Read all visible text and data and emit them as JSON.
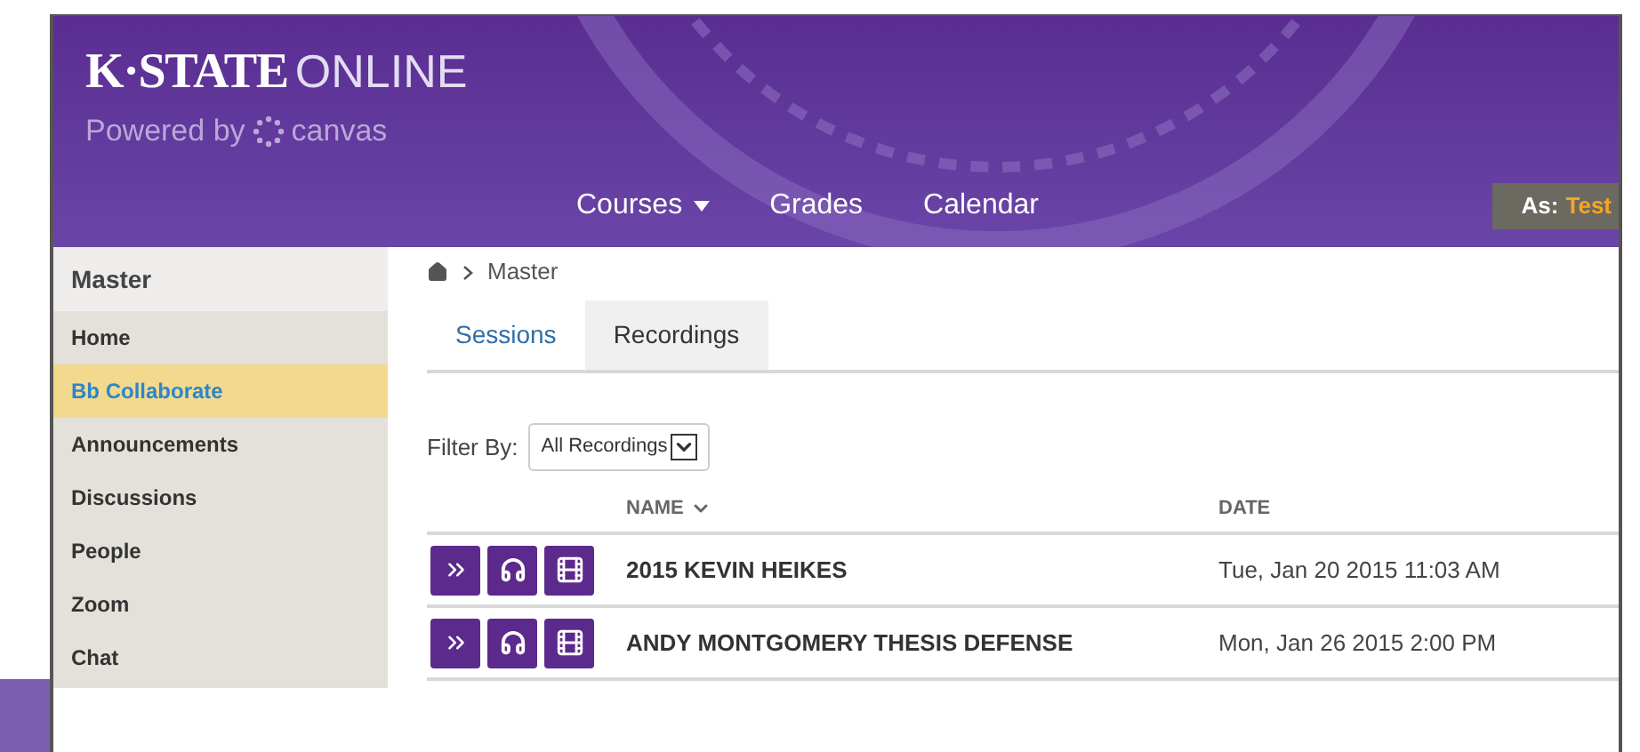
{
  "header": {
    "logo": {
      "brand": "K·STATE",
      "suffix": "ONLINE",
      "powered_by": "Powered by",
      "platform": "canvas"
    },
    "nav": [
      {
        "label": "Courses",
        "dropdown": true
      },
      {
        "label": "Grades",
        "dropdown": false
      },
      {
        "label": "Calendar",
        "dropdown": false
      }
    ],
    "masquerade": {
      "label": "As:",
      "user": "Test"
    }
  },
  "sidebar": {
    "title": "Master",
    "items": [
      {
        "label": "Home",
        "selected": false
      },
      {
        "label": "Bb Collaborate",
        "selected": true
      },
      {
        "label": "Announcements",
        "selected": false
      },
      {
        "label": "Discussions",
        "selected": false
      },
      {
        "label": "People",
        "selected": false
      },
      {
        "label": "Zoom",
        "selected": false
      },
      {
        "label": "Chat",
        "selected": false
      }
    ]
  },
  "breadcrumb": [
    "Master"
  ],
  "tabs": [
    {
      "label": "Sessions",
      "selected": false
    },
    {
      "label": "Recordings",
      "selected": true
    }
  ],
  "filter": {
    "label": "Filter By:",
    "value": "All Recordings"
  },
  "table": {
    "columns": [
      {
        "label": "NAME",
        "sorted": true
      },
      {
        "label": "DATE",
        "sorted": false
      }
    ],
    "rows": [
      {
        "name": "2015 KEVIN HEIKES",
        "date": "Tue, Jan 20 2015 11:03 AM"
      },
      {
        "name": "ANDY MONTGOMERY THESIS DEFENSE",
        "date": "Mon, Jan 26 2015 2:00 PM"
      }
    ]
  }
}
